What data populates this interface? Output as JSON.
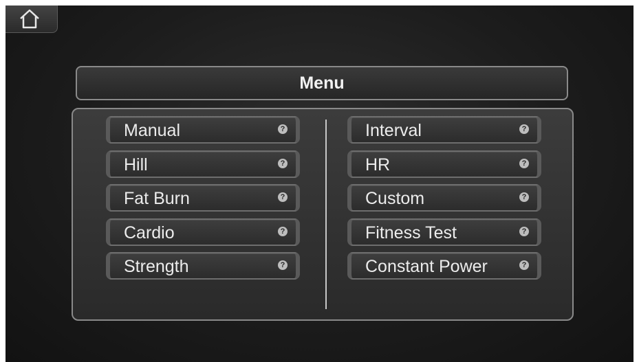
{
  "home": {
    "icon": "home-icon"
  },
  "header": {
    "title": "Menu"
  },
  "help_icon": {
    "glyph": "?",
    "icon": "help-icon"
  },
  "menu": {
    "left": [
      {
        "label": "Manual"
      },
      {
        "label": "Hill"
      },
      {
        "label": "Fat Burn"
      },
      {
        "label": "Cardio"
      },
      {
        "label": "Strength"
      }
    ],
    "right": [
      {
        "label": "Interval"
      },
      {
        "label": "HR"
      },
      {
        "label": "Custom"
      },
      {
        "label": "Fitness Test"
      },
      {
        "label": "Constant Power"
      }
    ]
  }
}
